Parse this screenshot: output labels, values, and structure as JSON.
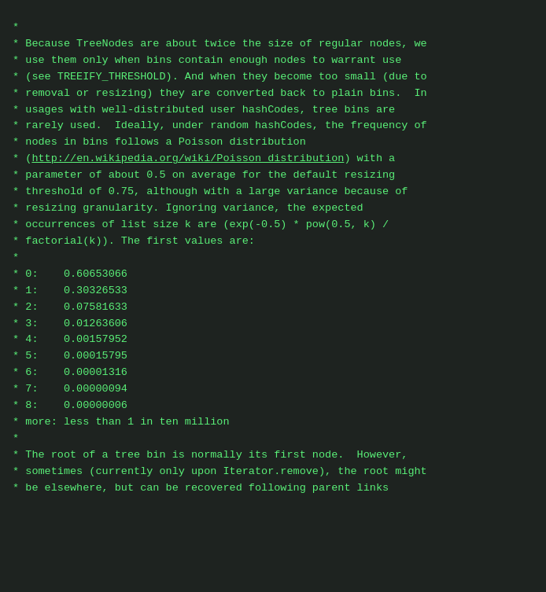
{
  "code": {
    "lines": [
      " *",
      " * Because TreeNodes are about twice the size of regular nodes, we",
      " * use them only when bins contain enough nodes to warrant use",
      " * (see TREEIFY_THRESHOLD). And when they become too small (due to",
      " * removal or resizing) they are converted back to plain bins.  In",
      " * usages with well-distributed user hashCodes, tree bins are",
      " * rarely used.  Ideally, under random hashCodes, the frequency of",
      " * nodes in bins follows a Poisson distribution",
      " * (http://en.wikipedia.org/wiki/Poisson_distribution) with a",
      " * parameter of about 0.5 on average for the default resizing",
      " * threshold of 0.75, although with a large variance because of",
      " * resizing granularity. Ignoring variance, the expected",
      " * occurrences of list size k are (exp(-0.5) * pow(0.5, k) /",
      " * factorial(k)). The first values are:",
      " *",
      " * 0:    0.60653066",
      " * 1:    0.30326533",
      " * 2:    0.07581633",
      " * 3:    0.01263606",
      " * 4:    0.00157952",
      " * 5:    0.00015795",
      " * 6:    0.00001316",
      " * 7:    0.00000094",
      " * 8:    0.00000006",
      " * more: less than 1 in ten million",
      " *",
      " * The root of a tree bin is normally its first node.  However,",
      " * sometimes (currently only upon Iterator.remove), the root might",
      " * be elsewhere, but can be recovered following parent links"
    ],
    "link_line": 8,
    "link_text": "http://en.wikipedia.org/wiki/Poisson_distribution",
    "link_prefix": " * (",
    "link_suffix": ") with a"
  }
}
